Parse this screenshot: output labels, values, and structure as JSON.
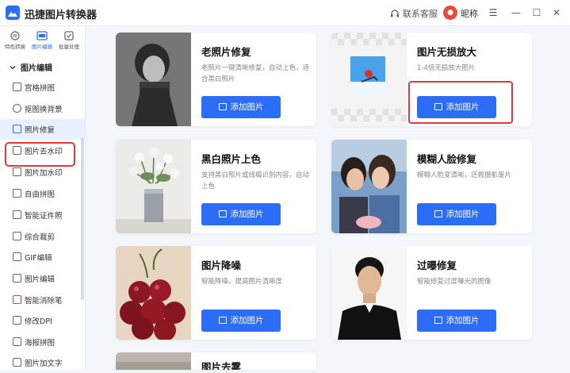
{
  "app": {
    "title": "迅捷图片转换器"
  },
  "header": {
    "service_label": "联系客服",
    "nickname": "昵称"
  },
  "modes": [
    {
      "label": "特色转换"
    },
    {
      "label": "图片编辑"
    },
    {
      "label": "批量处理"
    }
  ],
  "sidebar": {
    "section": "图片编辑",
    "items": [
      {
        "label": "宫格拼图"
      },
      {
        "label": "抠图换背景"
      },
      {
        "label": "照片修复"
      },
      {
        "label": "图片去水印"
      },
      {
        "label": "图片加水印"
      },
      {
        "label": "自由拼图"
      },
      {
        "label": "智能证件照"
      },
      {
        "label": "综合裁剪"
      },
      {
        "label": "GIF编辑"
      },
      {
        "label": "图片编辑"
      },
      {
        "label": "智能消除笔"
      },
      {
        "label": "修改DPI"
      },
      {
        "label": "海报拼图"
      },
      {
        "label": "图片加文字"
      }
    ]
  },
  "cards": [
    {
      "title": "老照片修复",
      "desc": "老照片一键清晰修复，自动上色，适合黑白照片",
      "button": "添加图片"
    },
    {
      "title": "图片无损放大",
      "desc": "1-4倍无损放大图片",
      "button": "添加图片"
    },
    {
      "title": "黑白照片上色",
      "desc": "支持黑白照片或线稿识别内容，自动上色",
      "button": "添加图片"
    },
    {
      "title": "模糊人脸修复",
      "desc": "模糊人脸变清晰，还救摄影废片",
      "button": "添加图片"
    },
    {
      "title": "图片降噪",
      "desc": "智能降噪，提高图片清晰度",
      "button": "添加图片"
    },
    {
      "title": "过曝修复",
      "desc": "智能修复过度曝光的图像",
      "button": "添加图片"
    },
    {
      "title": "图片去雾",
      "desc": "",
      "button": ""
    }
  ],
  "colors": {
    "accent": "#2d6cf6",
    "highlight": "#e53935"
  }
}
